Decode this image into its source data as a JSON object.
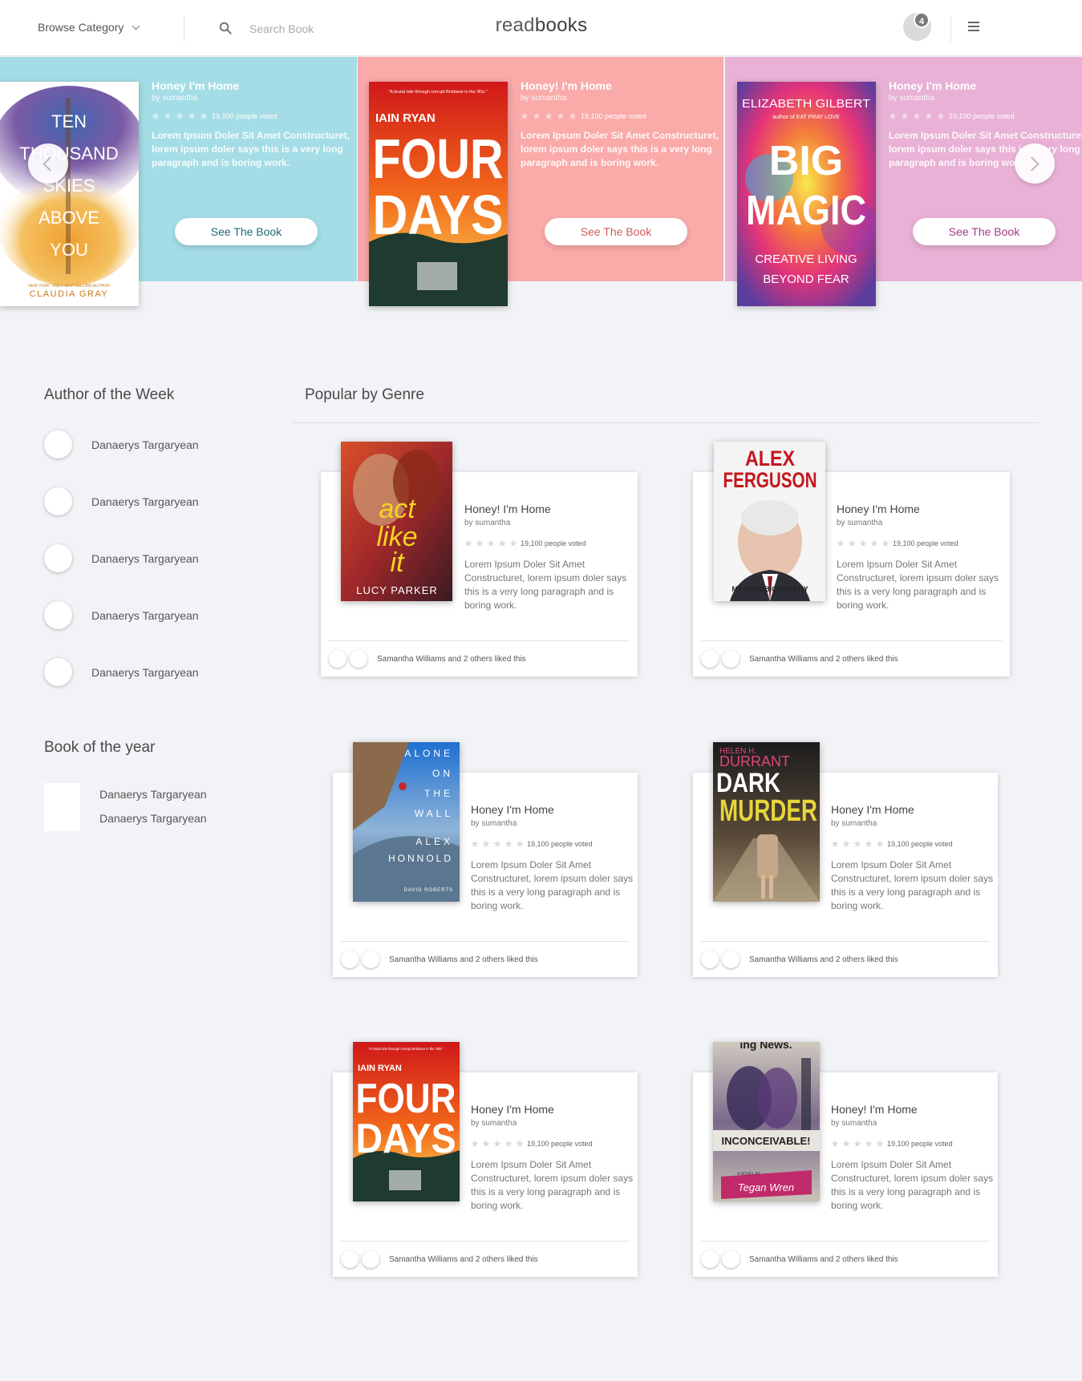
{
  "header": {
    "browse_label": "Browse Category",
    "search_placeholder": "Search Book",
    "logo_light": "read",
    "logo_bold": "books",
    "notification_count": "4"
  },
  "carousel": {
    "slides": [
      {
        "bg": "#a4dde6",
        "title": "Honey I'm Home",
        "author": "by sumantha",
        "votes": "19,100 people voted",
        "desc": "Lorem Ipsum Doler Sit Amet Constructuret, lorem ipsum doler says this is a very long paragraph and is boring work.",
        "button": "See The Book",
        "btn_color": "#1f6b75",
        "cover": {
          "title_lines": [
            "TEN",
            "THOUSAND",
            "SKIES",
            "ABOVE",
            "YOU"
          ],
          "author": "CLAUDIA GRAY",
          "tagline": "NEW YORK TIMES BESTSELLING AUTHOR"
        }
      },
      {
        "bg": "#f9aaa9",
        "title": "Honey! I'm Home",
        "author": "by sumantha",
        "votes": "19,100 people voted",
        "desc": "Lorem Ipsum Doler Sit Amet Constructuret, lorem ipsum doler says this is a very long paragraph and is boring work.",
        "button": "See The Book",
        "btn_color": "#d05a5a",
        "cover": {
          "title_lines": [
            "FOUR",
            "DAYS"
          ],
          "author": "IAIN RYAN",
          "tagline": "\"A brutal ride through corrupt Brisbane in the '80s.\""
        }
      },
      {
        "bg": "#e8b1d5",
        "title": "Honey I'm Home",
        "author": "by sumantha",
        "votes": "19,100 people voted",
        "desc": "Lorem Ipsum Doler Sit Amet Constructuret, lorem ipsum doler says this is a very long paragraph and is boring work.",
        "button": "See The Book",
        "btn_color": "#a03b7f",
        "cover": {
          "title_lines": [
            "BIG",
            "MAGIC"
          ],
          "author": "ELIZABETH GILBERT",
          "tagline": "author of EAT PRAY LOVE",
          "subtitle": [
            "CREATIVE LIVING",
            "BEYOND FEAR"
          ]
        }
      }
    ]
  },
  "sidebar": {
    "author_title": "Author of the Week",
    "authors": [
      "Danaerys Targaryean",
      "Danaerys Targaryean",
      "Danaerys Targaryean",
      "Danaerys Targaryean",
      "Danaerys Targaryean"
    ],
    "boty_title": "Book of the year",
    "boty_names": [
      "Danaerys Targaryean",
      "Danaerys Targaryean"
    ]
  },
  "genre": {
    "title": "Popular by Genre",
    "cards": [
      {
        "title": "Honey! I'm Home",
        "author": "by sumantha",
        "votes": "19,100 people voted",
        "desc": "Lorem Ipsum Doler Sit Amet Constructuret, lorem ipsum doler says this is a very long paragraph and is boring work.",
        "likes": "Samantha Williams and 2 others liked this",
        "cover": {
          "title_lines": [
            "act",
            "like",
            "it"
          ],
          "author": "LUCY PARKER"
        }
      },
      {
        "title": "Honey I'm Home",
        "author": "by sumantha",
        "votes": "19,100 people voted",
        "desc": "Lorem Ipsum Doler Sit Amet Constructuret, lorem ipsum doler says this is a very long paragraph and is boring work.",
        "likes": "Samantha Williams and 2 others liked this",
        "cover": {
          "title_lines": [
            "ALEX",
            "FERGUSON"
          ],
          "subtitle": "MY AUTOBIOGRAPHY"
        }
      },
      {
        "title": "Honey I'm Home",
        "author": "by sumantha",
        "votes": "19,100 people voted",
        "desc": "Lorem Ipsum Doler Sit Amet Constructuret, lorem ipsum doler says this is a very long paragraph and is boring work.",
        "likes": "Samantha Williams and 2 others liked this",
        "cover": {
          "title_lines": [
            "ALONE",
            "ON",
            "THE",
            "WALL"
          ],
          "author_lines": [
            "ALEX",
            "HONNOLD"
          ],
          "with": "DAVID ROBERTS"
        }
      },
      {
        "title": "Honey I'm Home",
        "author": "by sumantha",
        "votes": "19,100 people voted",
        "desc": "Lorem Ipsum Doler Sit Amet Constructuret, lorem ipsum doler says this is a very long paragraph and is boring work.",
        "likes": "Samantha Williams and 2 others liked this",
        "cover": {
          "author_lines": [
            "HELEN H.",
            "DURRANT"
          ],
          "title_lines": [
            "DARK",
            "MURDER"
          ]
        }
      },
      {
        "title": "Honey I'm Home",
        "author": "by sumantha",
        "votes": "19,100 people voted",
        "desc": "Lorem Ipsum Doler Sit Amet Constructuret, lorem ipsum doler says this is a very long paragraph and is boring work.",
        "likes": "Samantha Williams and 2 others liked this",
        "cover": {
          "title_lines": [
            "FOUR",
            "DAYS"
          ],
          "author": "IAIN RYAN",
          "tagline": "\"A brutal ride through corrupt Brisbane in the '80s.\""
        }
      },
      {
        "title": "Honey! I'm Home",
        "author": "by sumantha",
        "votes": "19,100 people voted",
        "desc": "Lorem Ipsum Doler Sit Amet Constructuret, lorem ipsum doler says this is a very long paragraph and is boring work.",
        "likes": "Samantha Williams and 2 others liked this",
        "cover": {
          "title_lines": [
            "INCONCEIVABLE!"
          ],
          "author": "Tegan Wren",
          "tagline": "A NOVEL BY",
          "masthead": "ing News."
        }
      }
    ]
  },
  "colors": {
    "star_light": "#ffffff",
    "star_grey": "#d9d9d9",
    "card_bg": "#ffffff",
    "page_bg": "#f1f3f6"
  }
}
